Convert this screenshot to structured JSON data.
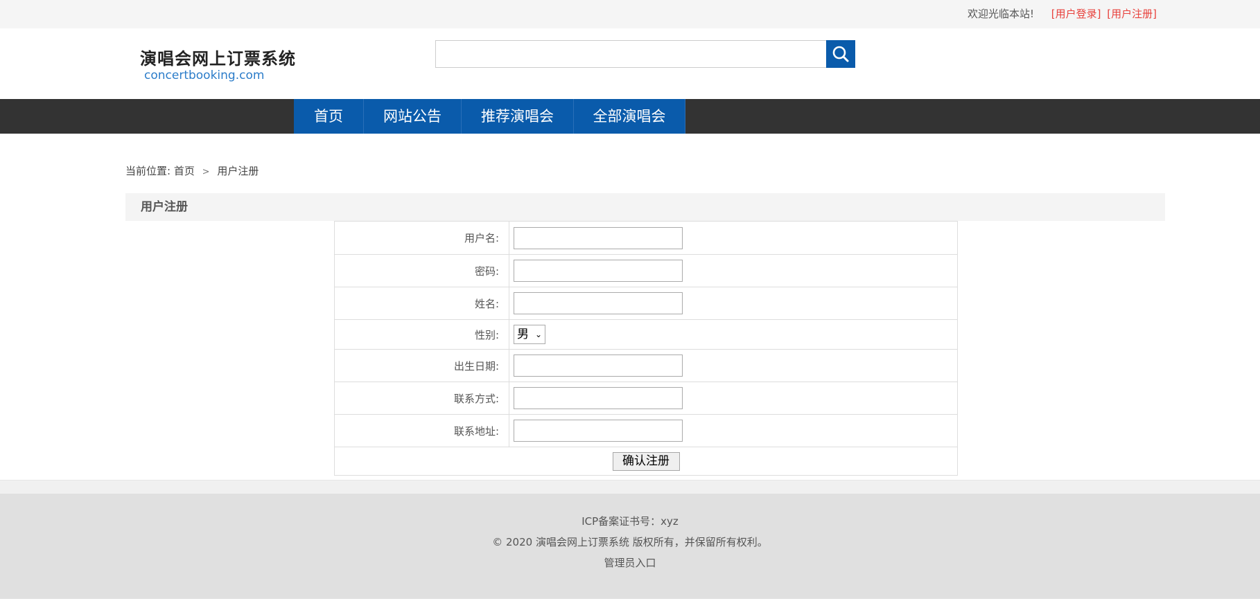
{
  "topbar": {
    "welcome": "欢迎光临本站!",
    "login_link": "[用户登录]",
    "register_link": "[用户注册]"
  },
  "header": {
    "logo_title": "演唱会网上订票系统",
    "logo_domain": "concertbooking.com",
    "search_placeholder": "",
    "search_icon": "search-icon"
  },
  "nav": {
    "items": [
      {
        "label": "首页"
      },
      {
        "label": "网站公告"
      },
      {
        "label": "推荐演唱会"
      },
      {
        "label": "全部演唱会"
      }
    ]
  },
  "breadcrumb": {
    "prefix": "当前位置:",
    "home": "首页",
    "current": "用户注册"
  },
  "section": {
    "title": "用户注册"
  },
  "form": {
    "fields": [
      {
        "label": "用户名:",
        "value": ""
      },
      {
        "label": "密码:",
        "value": ""
      },
      {
        "label": "姓名:",
        "value": ""
      },
      {
        "label": "性别:",
        "selected": "男"
      },
      {
        "label": "出生日期:",
        "value": ""
      },
      {
        "label": "联系方式:",
        "value": ""
      },
      {
        "label": "联系地址:",
        "value": ""
      }
    ],
    "submit_label": "确认注册"
  },
  "footer": {
    "icp": "ICP备案证书号：xyz",
    "copyright": "© 2020 演唱会网上订票系统 版权所有，并保留所有权利。",
    "admin_link": "管理员入口"
  },
  "colors": {
    "brand_blue": "#0a5bab",
    "nav_dark": "#333333",
    "link_red": "#e8413c"
  }
}
